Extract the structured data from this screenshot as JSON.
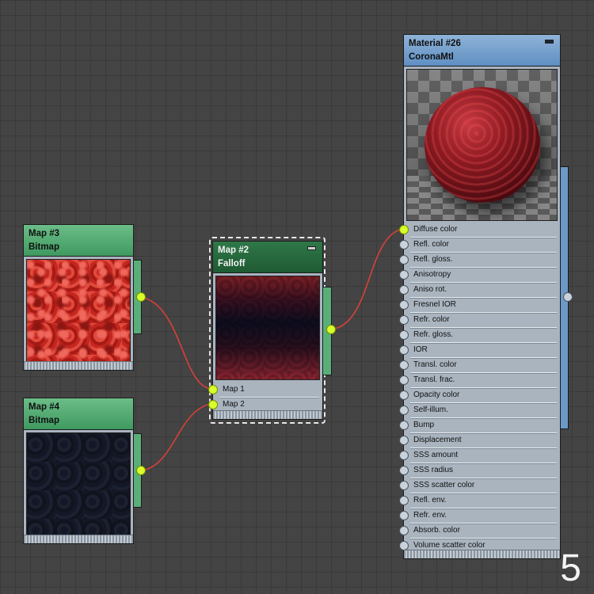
{
  "nodes": {
    "map3": {
      "title": "Map #3",
      "subtitle": "Bitmap"
    },
    "map4": {
      "title": "Map #4",
      "subtitle": "Bitmap"
    },
    "map2": {
      "title": "Map #2",
      "subtitle": "Falloff",
      "slots": [
        "Map 1",
        "Map 2"
      ]
    },
    "material": {
      "title": "Material #26",
      "subtitle": "CoronaMtl",
      "slots": [
        "Diffuse color",
        "Refl. color",
        "Refl. gloss.",
        "Anisotropy",
        "Aniso rot.",
        "Fresnel IOR",
        "Refr. color",
        "Refr. gloss.",
        "IOR",
        "Transl. color",
        "Transl. frac.",
        "Opacity color",
        "Self-illum.",
        "Bump",
        "Displacement",
        "SSS amount",
        "SSS radius",
        "SSS scatter color",
        "Refl. env.",
        "Refr. env.",
        "Absorb. color",
        "Volume scatter color"
      ]
    }
  },
  "corner_label": "5",
  "colors": {
    "wire": "#d8403a",
    "socket_active": "#d6ff2b",
    "node_header_green": "#4fa86e",
    "node_header_blue": "#6f9bcb"
  }
}
